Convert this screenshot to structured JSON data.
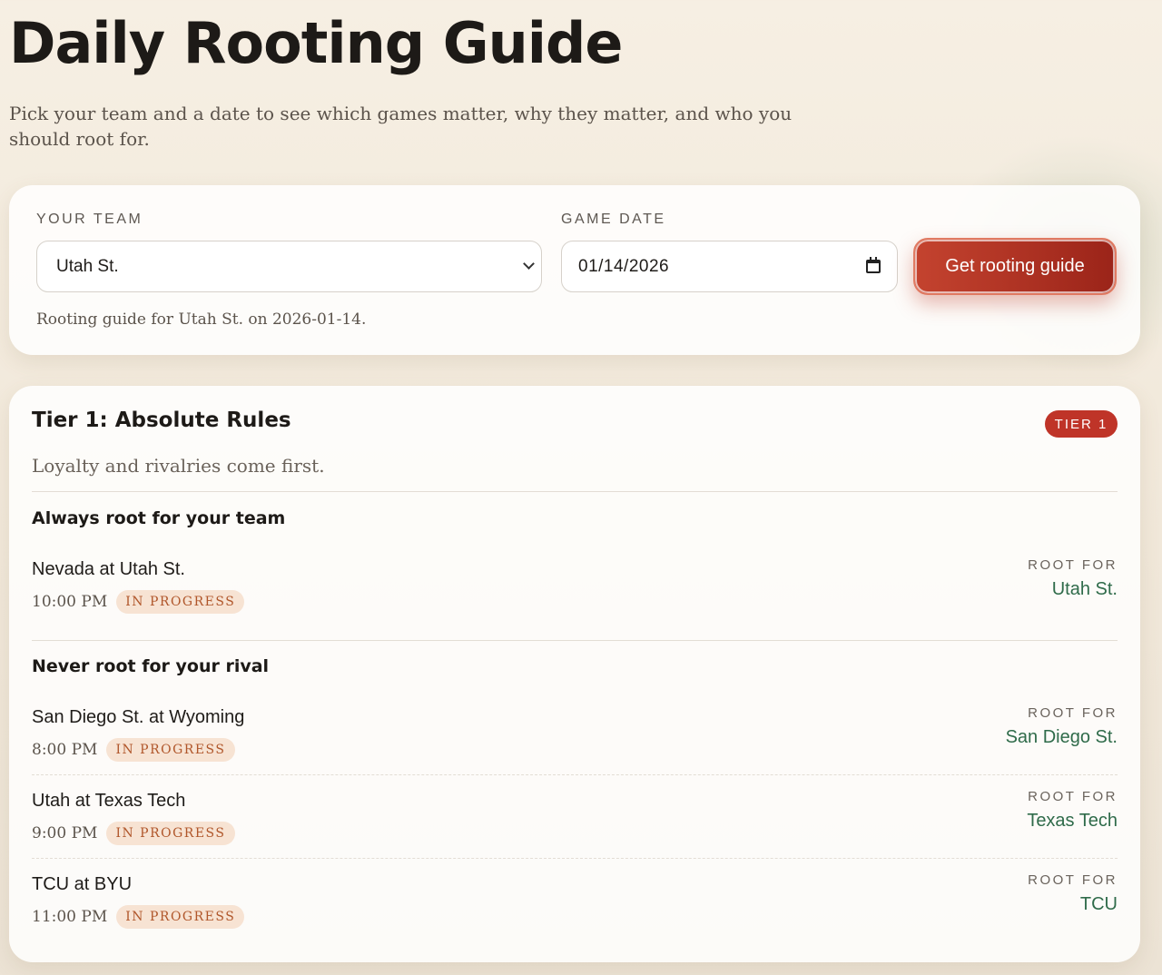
{
  "header": {
    "title": "Daily Rooting Guide",
    "subtitle": "Pick your team and a date to see which games matter, why they matter, and who you should root for."
  },
  "controls": {
    "team_label": "YOUR TEAM",
    "team_value": "Utah St.",
    "date_label": "GAME DATE",
    "date_value": "01/14/2026",
    "submit_label": "Get rooting guide",
    "status_text": "Rooting guide for Utah St. on 2026-01-14."
  },
  "tier": {
    "title": "Tier 1: Absolute Rules",
    "badge": "TIER 1",
    "subtitle": "Loyalty and rivalries come first.",
    "groups": [
      {
        "title": "Always root for your team",
        "games": [
          {
            "matchup": "Nevada at Utah St.",
            "time": "10:00 PM",
            "status": "IN PROGRESS",
            "root_label": "ROOT FOR",
            "root_team": "Utah St."
          }
        ]
      },
      {
        "title": "Never root for your rival",
        "games": [
          {
            "matchup": "San Diego St. at Wyoming",
            "time": "8:00 PM",
            "status": "IN PROGRESS",
            "root_label": "ROOT FOR",
            "root_team": "San Diego St."
          },
          {
            "matchup": "Utah at Texas Tech",
            "time": "9:00 PM",
            "status": "IN PROGRESS",
            "root_label": "ROOT FOR",
            "root_team": "Texas Tech"
          },
          {
            "matchup": "TCU at BYU",
            "time": "11:00 PM",
            "status": "IN PROGRESS",
            "root_label": "ROOT FOR",
            "root_team": "TCU"
          }
        ]
      }
    ]
  },
  "colors": {
    "accent": "#bf3428",
    "root_team": "#2f6b4a",
    "status_pill_bg": "#f7e3d3",
    "status_pill_text": "#b0562a"
  },
  "icons": {
    "team_select": "chevron-down-icon",
    "date_field": "calendar-icon"
  }
}
